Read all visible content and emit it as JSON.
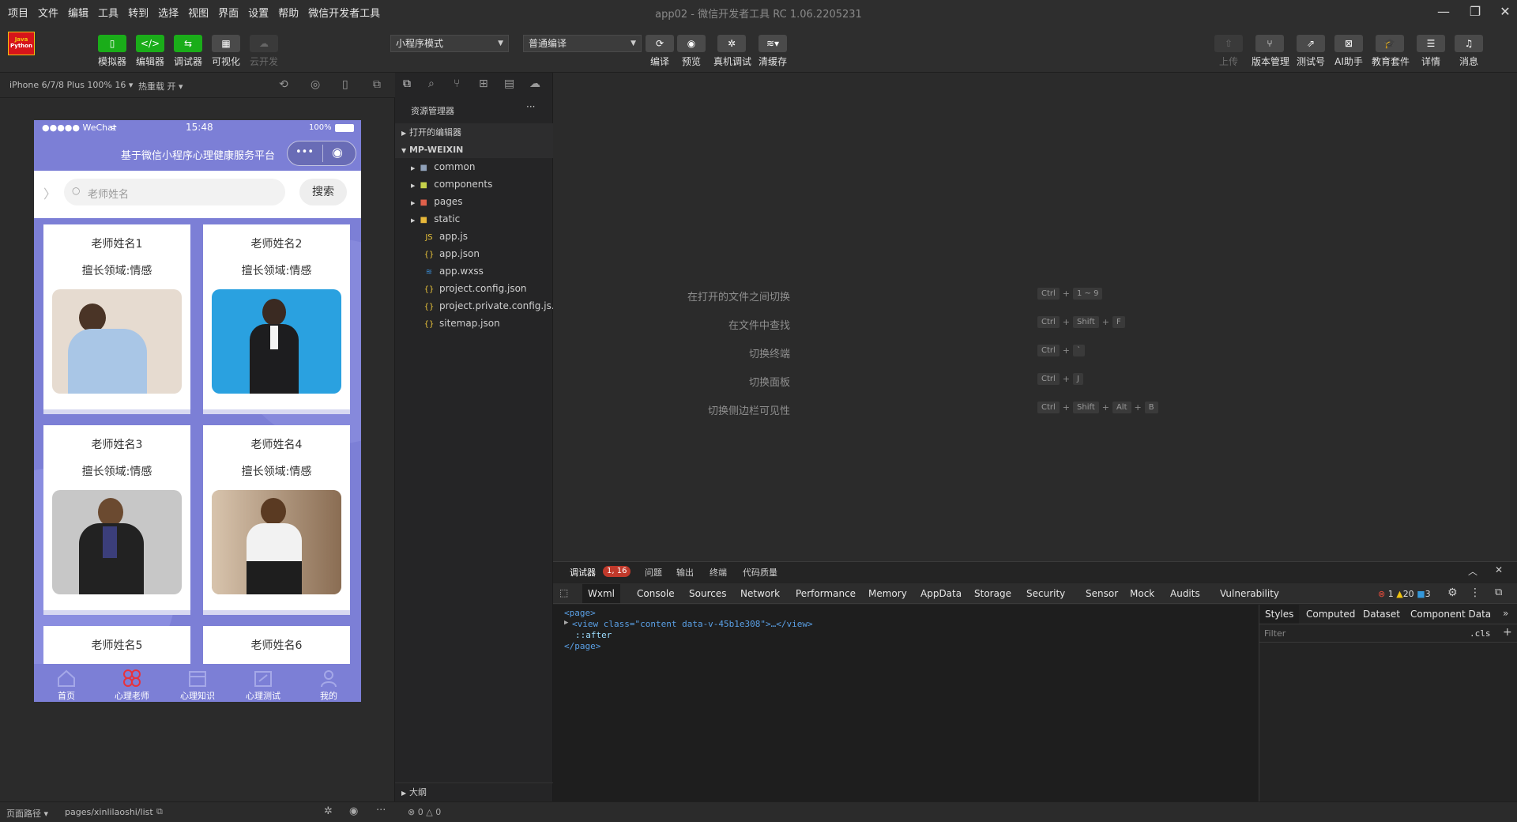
{
  "menu": [
    "项目",
    "文件",
    "编辑",
    "工具",
    "转到",
    "选择",
    "视图",
    "界面",
    "设置",
    "帮助",
    "微信开发者工具"
  ],
  "window_title": "app02 - 微信开发者工具 RC 1.06.2205231",
  "logo_text": [
    "Java",
    "Python"
  ],
  "toolbar": {
    "left_buttons": [
      "模拟器",
      "编辑器",
      "调试器",
      "可视化",
      "云开发"
    ],
    "mode_select": "小程序模式",
    "compile_select": "普通编译",
    "mid_buttons": [
      "编译",
      "预览",
      "真机调试",
      "清缓存"
    ],
    "right_buttons": [
      "上传",
      "版本管理",
      "测试号",
      "AI助手",
      "教育套件",
      "详情",
      "消息"
    ]
  },
  "sim_bar": {
    "device": "iPhone 6/7/8 Plus 100% 16",
    "hot_reload": "热重载 开"
  },
  "phone": {
    "carrier": "●●●●● WeChat",
    "time": "15:48",
    "battery": "100%",
    "nav_title": "基于微信小程序心理健康服务平台",
    "search_placeholder": "老师姓名",
    "search_button": "搜索",
    "cards": [
      {
        "name": "老师姓名1",
        "field": "擅长领域:情感",
        "bg": "#d9c7b8"
      },
      {
        "name": "老师姓名2",
        "field": "擅长领域:情感",
        "bg": "#2aa1e0"
      },
      {
        "name": "老师姓名3",
        "field": "擅长领域:情感",
        "bg": "#b3b3b3"
      },
      {
        "name": "老师姓名4",
        "field": "擅长领域:情感",
        "bg": "#a88a6c"
      },
      {
        "name": "老师姓名5",
        "field": "",
        "bg": "#ffffff"
      },
      {
        "name": "老师姓名6",
        "field": "",
        "bg": "#ffffff"
      }
    ],
    "tabs": [
      "首页",
      "心理老师",
      "心理知识",
      "心理测试",
      "我的"
    ],
    "active_color": "#e8323c"
  },
  "explorer": {
    "title": "资源管理器",
    "open_editors": "打开的编辑器",
    "project": "MP-WEIXIN",
    "folders": [
      "common",
      "components",
      "pages",
      "static"
    ],
    "files": [
      "app.js",
      "app.json",
      "app.wxss",
      "project.config.json",
      "project.private.config.js...",
      "sitemap.json"
    ],
    "outline": "大纲"
  },
  "shortcuts": [
    {
      "label": "在打开的文件之间切换",
      "keys": [
        "Ctrl",
        "1 ~ 9"
      ]
    },
    {
      "label": "在文件中查找",
      "keys": [
        "Ctrl",
        "Shift",
        "F"
      ]
    },
    {
      "label": "切换终端",
      "keys": [
        "Ctrl",
        "`"
      ]
    },
    {
      "label": "切换面板",
      "keys": [
        "Ctrl",
        "J"
      ]
    },
    {
      "label": "切换侧边栏可见性",
      "keys": [
        "Ctrl",
        "Shift",
        "Alt",
        "B"
      ]
    }
  ],
  "devtools": {
    "top_tabs": [
      "调试器",
      "问题",
      "输出",
      "终端",
      "代码质量"
    ],
    "badge": "1, 16",
    "panel_tabs": [
      "Wxml",
      "Console",
      "Sources",
      "Network",
      "Performance",
      "Memory",
      "AppData",
      "Storage",
      "Security",
      "Sensor",
      "Mock",
      "Audits",
      "Vulnerability"
    ],
    "counts": {
      "errors": "1",
      "warnings": "20",
      "info": "3"
    },
    "wxml_lines": [
      "<page>",
      "<view class=\"content data-v-45b1e308\">…</view>",
      "::after",
      "</page>"
    ],
    "styles_tabs": [
      "Styles",
      "Computed",
      "Dataset",
      "Component Data"
    ],
    "filter_placeholder": "Filter",
    "cls": ".cls"
  },
  "status": {
    "path_label": "页面路径",
    "path": "pages/xinlilaoshi/list",
    "errors": "0",
    "warnings": "0"
  }
}
